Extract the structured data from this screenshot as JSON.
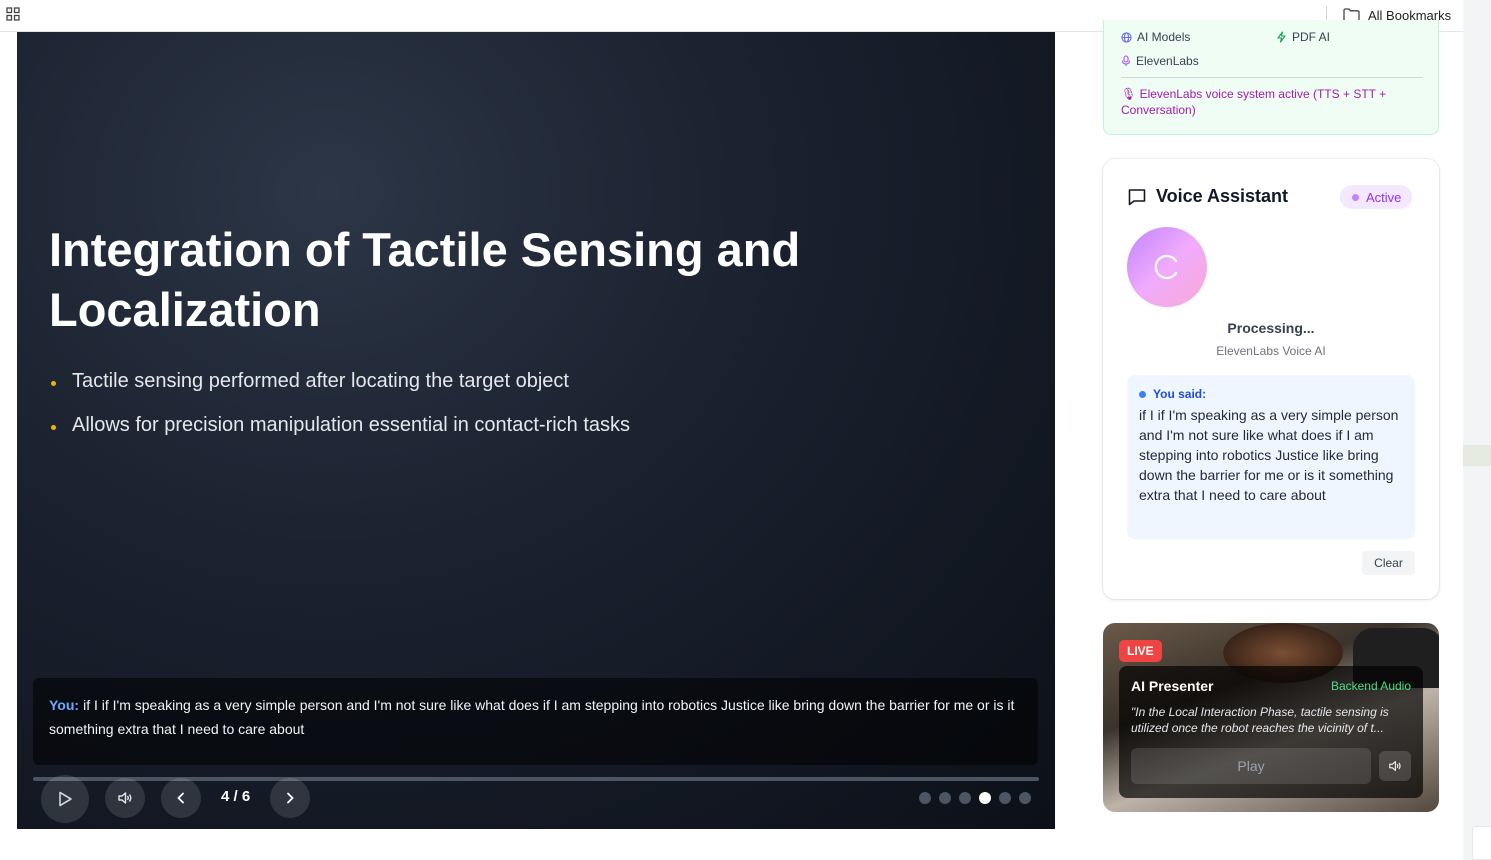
{
  "bookmarks_bar": {
    "apps_icon": "apps-grid-icon",
    "all_bookmarks_label": "All Bookmarks",
    "folder_icon": "folder-icon"
  },
  "slide": {
    "title": "Integration of Tactile Sensing and Localization",
    "bullets": [
      "Tactile sensing performed after locating the target object",
      "Allows for precision manipulation essential in contact-rich tasks"
    ],
    "bullet_color": "#f5b301",
    "transcript": {
      "speaker_label": "You:",
      "text": "if I if I'm speaking as a very simple person and I'm not sure like what does if I am stepping into robotics Justice like bring down the barrier for me or is it something extra that I need to care about"
    },
    "controls": {
      "page_counter": "4 / 6",
      "current_page": 4,
      "total_pages": 6,
      "progress": 0
    }
  },
  "integrations": {
    "items": [
      {
        "label": "AI Models",
        "icon": "globe-icon"
      },
      {
        "label": "PDF AI",
        "icon": "lightning-icon"
      },
      {
        "label": "ElevenLabs",
        "icon": "microphone-icon"
      }
    ],
    "status": "🎙 ElevenLabs voice system active (TTS + STT + Conversation)"
  },
  "voice_assistant": {
    "title": "Voice Assistant",
    "badge": "Active",
    "status": "Processing...",
    "provider": "ElevenLabs Voice AI",
    "you_said_label": "You said:",
    "you_said_text": "if I if I'm speaking as a very simple person and I'm not sure like what does if I am stepping into robotics Justice like bring down the barrier for me or is it something extra that I need to care about",
    "clear_label": "Clear"
  },
  "presenter": {
    "live_label": "LIVE",
    "name": "AI Presenter",
    "audio_source": "Backend Audio",
    "quote": "\"In the Local Interaction Phase, tactile sensing is utilized once the robot reaches the vicinity of t...",
    "play_label": "Play"
  }
}
